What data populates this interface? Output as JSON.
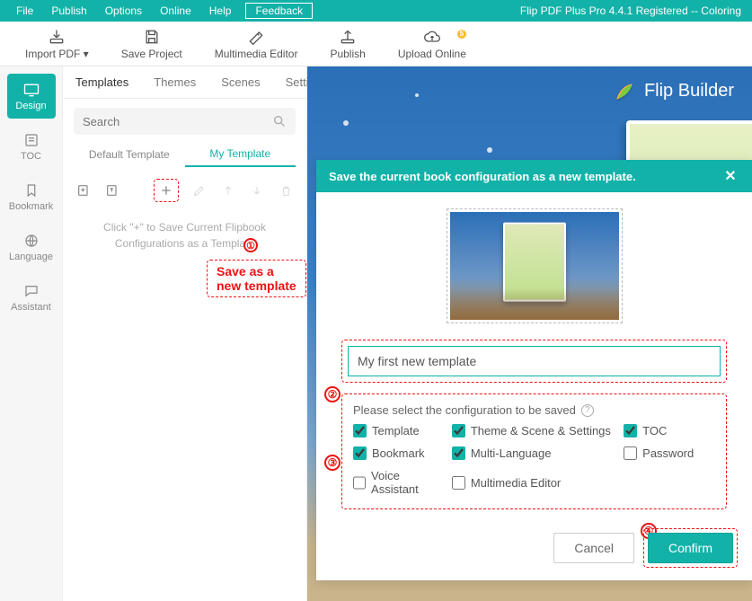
{
  "menubar": {
    "items": [
      "File",
      "Publish",
      "Options",
      "Online",
      "Help"
    ],
    "feedback": "Feedback",
    "title": "Flip PDF Plus Pro 4.4.1 Registered -- Coloring"
  },
  "toolbar": {
    "import": "Import PDF ▾",
    "save": "Save Project",
    "mme": "Multimedia Editor",
    "publish": "Publish",
    "upload": "Upload Online"
  },
  "leftnav": {
    "design": "Design",
    "toc": "TOC",
    "bookmark": "Bookmark",
    "language": "Language",
    "assistant": "Assistant"
  },
  "midpanel": {
    "tabs": [
      "Templates",
      "Themes",
      "Scenes",
      "Settings"
    ],
    "search_placeholder": "Search",
    "subtabs": [
      "Default Template",
      "My Template"
    ],
    "hint": "Click \"+\" to Save Current Flipbook Configurations as a Template",
    "callout_label": "Save as a new template",
    "callout_badges": [
      "①",
      "②",
      "③",
      "④"
    ]
  },
  "preview": {
    "brand": "Flip Builder"
  },
  "dialog": {
    "title": "Save the current book configuration as a new template.",
    "name_value": "My first new template",
    "config_heading": "Please select the configuration to be saved",
    "options": {
      "template": {
        "label": "Template",
        "checked": true
      },
      "theme": {
        "label": "Theme & Scene & Settings",
        "checked": true
      },
      "toc": {
        "label": "TOC",
        "checked": true
      },
      "bookmark": {
        "label": "Bookmark",
        "checked": true
      },
      "multilang": {
        "label": "Multi-Language",
        "checked": true
      },
      "password": {
        "label": "Password",
        "checked": false
      },
      "voice": {
        "label": "Voice Assistant",
        "checked": false
      },
      "mme": {
        "label": "Multimedia Editor",
        "checked": false
      }
    },
    "cancel": "Cancel",
    "confirm": "Confirm"
  }
}
